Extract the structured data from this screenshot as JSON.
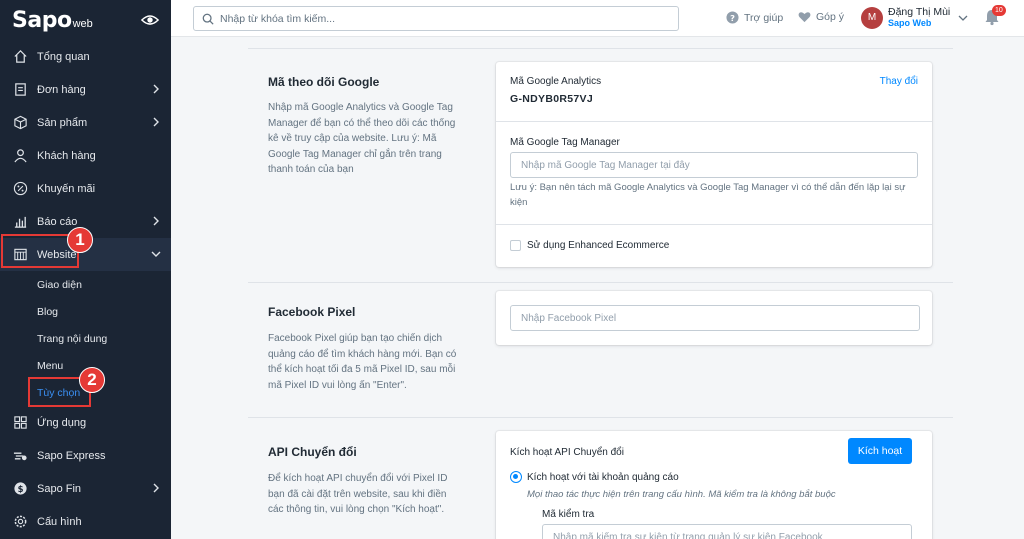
{
  "sidebar": {
    "logo": "Sapo",
    "logo_sub": "web",
    "items": [
      {
        "label": "Tổng quan",
        "icon": "home-icon"
      },
      {
        "label": "Đơn hàng",
        "icon": "orders-icon"
      },
      {
        "label": "Sản phẩm",
        "icon": "box-icon"
      },
      {
        "label": "Khách hàng",
        "icon": "user-icon"
      },
      {
        "label": "Khuyến mãi",
        "icon": "percent-icon"
      },
      {
        "label": "Báo cáo",
        "icon": "chart-icon"
      },
      {
        "label": "Website",
        "icon": "website-icon"
      }
    ],
    "website_sub": [
      "Giao diện",
      "Blog",
      "Trang nội dung",
      "Menu",
      "Tùy chọn"
    ],
    "bottom_items": [
      {
        "label": "Ứng dụng",
        "icon": "apps-icon"
      },
      {
        "label": "Sapo Express",
        "icon": "express-icon"
      },
      {
        "label": "Sapo Fin",
        "icon": "fin-icon"
      },
      {
        "label": "Cấu hình",
        "icon": "gear-icon"
      }
    ],
    "callouts": [
      "1",
      "2"
    ]
  },
  "topbar": {
    "search_placeholder": "Nhập từ khóa tìm kiếm...",
    "help": "Trợ giúp",
    "feedback": "Góp ý",
    "user_initial": "M",
    "user_name": "Đặng Thị Mùi",
    "shop_name": "Sapo Web",
    "notif_count": "10"
  },
  "google": {
    "title": "Mã theo dõi Google",
    "desc": "Nhập mã Google Analytics và Google Tag Manager để bạn có thể theo dõi các thống kê về truy cập của website. Lưu ý: Mã Google Tag Manager chỉ gắn trên trang thanh toán của bạn",
    "ga_label": "Mã Google Analytics",
    "ga_value": "G-NDYB0R57VJ",
    "change": "Thay đổi",
    "gtm_label": "Mã Google Tag Manager",
    "gtm_placeholder": "Nhập mã Google Tag Manager tại đây",
    "note": "Lưu ý: Bạn nên tách mã Google Analytics và Google Tag Manager vì có thể dẫn đến lặp lại sự kiện",
    "enhanced": "Sử dụng Enhanced Ecommerce"
  },
  "facebook": {
    "title": "Facebook Pixel",
    "desc": "Facebook Pixel giúp bạn tạo chiến dịch quảng cáo để tìm khách hàng mới. Bạn có thể kích hoạt tối đa 5 mã Pixel ID, sau mỗi mã Pixel ID vui lòng ấn \"Enter\".",
    "placeholder": "Nhập Facebook Pixel"
  },
  "api": {
    "title": "API Chuyển đổi",
    "desc": "Để kích hoạt API chuyển đổi với Pixel ID bạn đã cài đặt trên website, sau khi điền các thông tin, vui lòng chọn \"Kích hoạt\".",
    "activate_label": "Kích hoạt API Chuyển đổi",
    "activate_button": "Kích hoạt",
    "radio_label": "Kích hoạt với tài khoản quảng cáo",
    "radio_note": "Mọi thao tác thực hiện trên trang cấu hình. Mã kiểm tra là không bắt buộc",
    "test_label": "Mã kiểm tra",
    "test_placeholder": "Nhập mã kiểm tra sự kiện từ trang quản lý sự kiện Facebook"
  }
}
